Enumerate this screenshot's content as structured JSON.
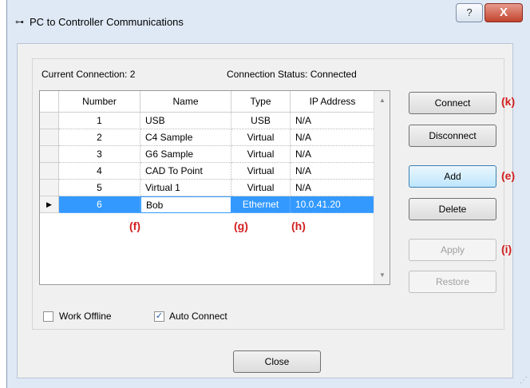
{
  "window": {
    "title": "PC to Controller Communications",
    "title_icon": "connector-icon",
    "help_glyph": "?",
    "close_glyph": "X"
  },
  "status": {
    "current_connection": "Current Connection: 2",
    "connection_status": "Connection Status: Connected"
  },
  "table": {
    "columns": [
      "Number",
      "Name",
      "Type",
      "IP Address"
    ],
    "rows": [
      {
        "number": "1",
        "name": "USB",
        "type": "USB",
        "ip": "N/A"
      },
      {
        "number": "2",
        "name": "C4 Sample",
        "type": "Virtual",
        "ip": "N/A"
      },
      {
        "number": "3",
        "name": "G6 Sample",
        "type": "Virtual",
        "ip": "N/A"
      },
      {
        "number": "4",
        "name": "CAD To Point",
        "type": "Virtual",
        "ip": "N/A"
      },
      {
        "number": "5",
        "name": "Virtual 1",
        "type": "Virtual",
        "ip": "N/A"
      },
      {
        "number": "6",
        "name": "Bob",
        "type": "Ethernet",
        "ip": "10.0.41.20"
      }
    ],
    "selected_row_marker": "▶"
  },
  "buttons": {
    "connect": "Connect",
    "disconnect": "Disconnect",
    "add": "Add",
    "delete": "Delete",
    "apply": "Apply",
    "restore": "Restore",
    "close": "Close"
  },
  "options": {
    "work_offline": {
      "label": "Work Offline",
      "checked": false
    },
    "auto_connect": {
      "label": "Auto Connect",
      "checked": true
    }
  },
  "annotations": {
    "k": "(k)",
    "e": "(e)",
    "i": "(i)",
    "f": "(f)",
    "g": "(g)",
    "h": "(h)"
  },
  "colors": {
    "selection": "#3399ff",
    "annotation": "#d21f1f",
    "window_frame": "#dfe9f5"
  }
}
